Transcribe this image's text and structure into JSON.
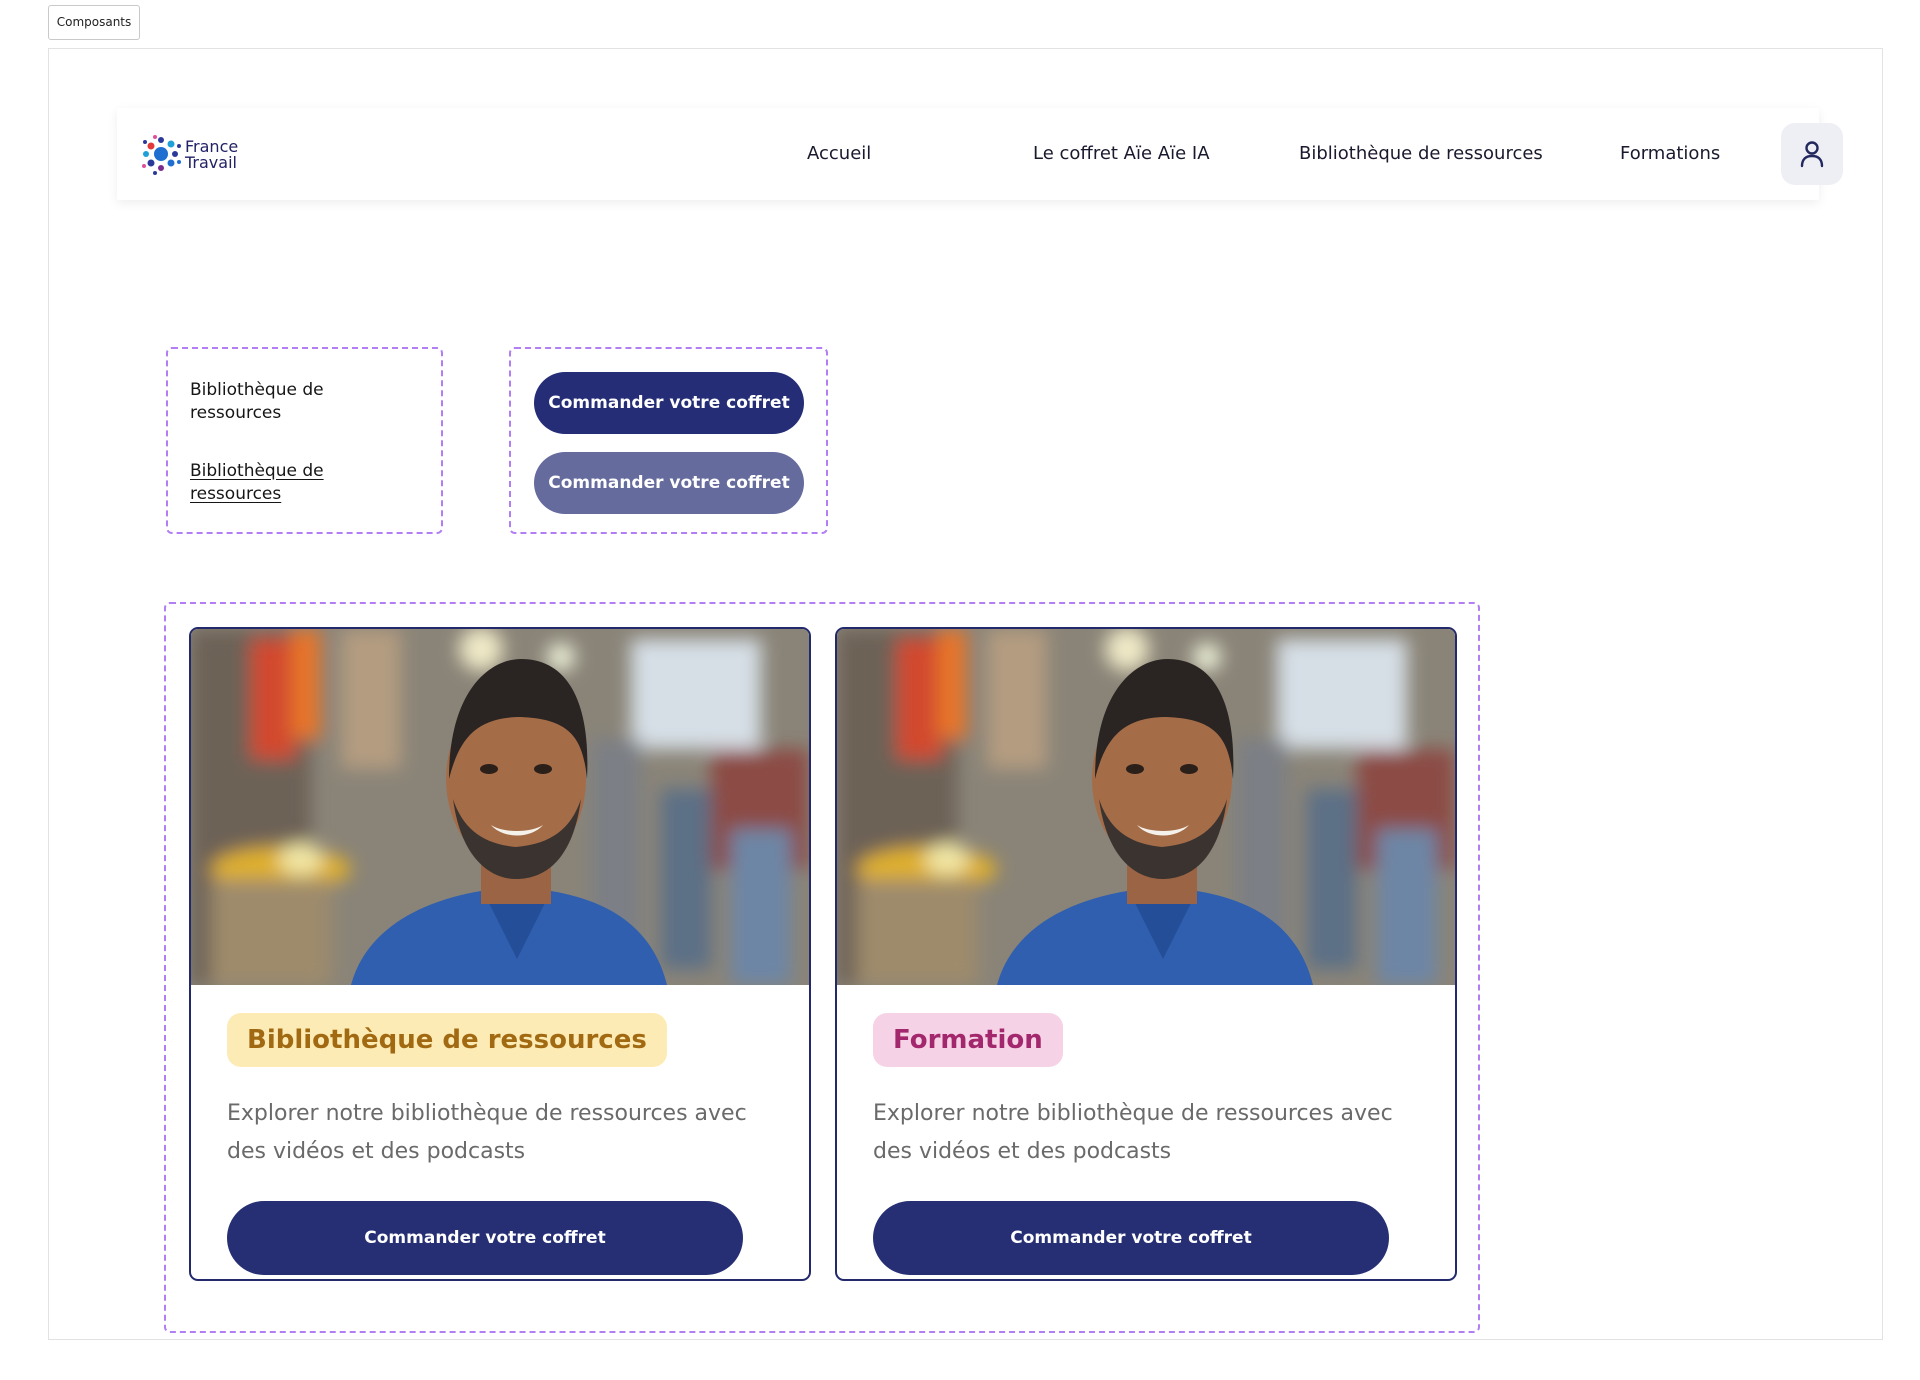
{
  "tag": {
    "label": "Composants"
  },
  "header": {
    "logo_text_line1": "France",
    "logo_text_line2": "Travail",
    "nav": {
      "home": "Accueil",
      "coffret": "Le coffret Aïe Aïe IA",
      "library": "Bibliothèque de ressources",
      "formations": "Formations"
    },
    "user_icon": "user-icon"
  },
  "links": {
    "default": "Bibliothèque de ressources",
    "hover": "Bibliothèque de ressources"
  },
  "buttons": {
    "primary": "Commander votre coffret",
    "hover": "Commander votre coffret"
  },
  "cards": [
    {
      "badge": "Bibliothèque de ressources",
      "badge_color": "#fdebb5",
      "badge_text_color": "#a16a12",
      "description": "Explorer notre bibliothèque de ressources avec des vidéos et des podcasts",
      "button": "Commander votre coffret"
    },
    {
      "badge": "Formation",
      "badge_color": "#f6d2e6",
      "badge_text_color": "#a3276c",
      "description": "Explorer notre bibliothèque de ressources avec des vidéos et des podcasts",
      "button": "Commander votre coffret"
    }
  ],
  "colors": {
    "primary_button": "#252d77",
    "hover_button": "#666b9e",
    "dashed_outline": "#b27ef4",
    "card_border": "#232a6b"
  }
}
